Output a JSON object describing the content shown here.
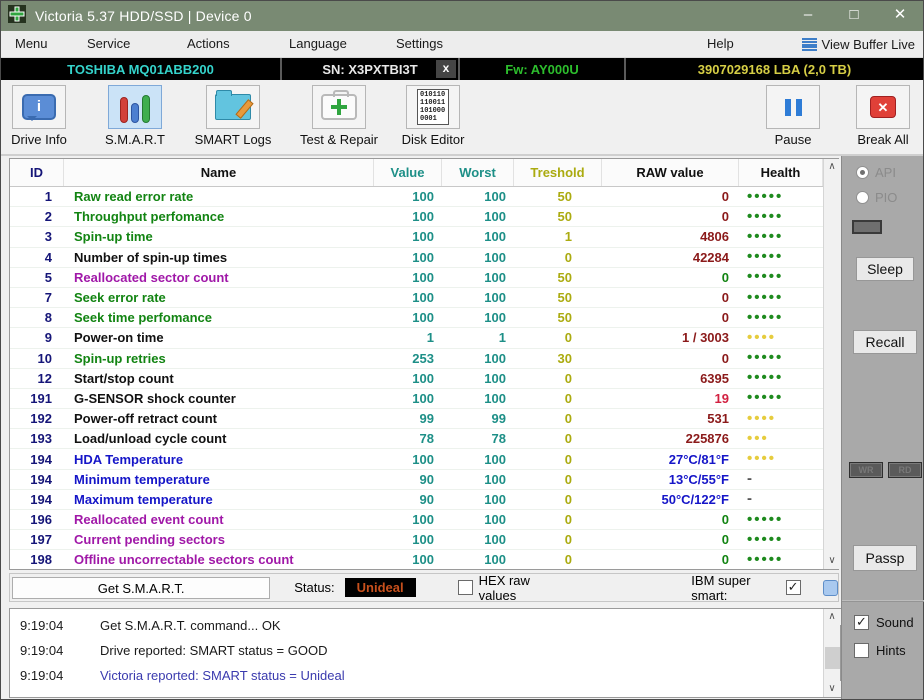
{
  "window": {
    "title": "Victoria 5.37 HDD/SSD | Device 0",
    "minimize": "–",
    "maximize": "□",
    "close": "✕"
  },
  "menubar": {
    "items": [
      "Menu",
      "Service",
      "Actions",
      "Language",
      "Settings",
      "Help"
    ],
    "view_buffer": "View Buffer Live"
  },
  "drivebar": {
    "model": "TOSHIBA MQ01ABB200",
    "serial": "SN: X3PXTBI3T",
    "close": "x",
    "firmware": "Fw: AY000U",
    "capacity": "3907029168 LBA (2,0 TB)"
  },
  "toolbar": {
    "buttons": [
      {
        "label": "Drive Info"
      },
      {
        "label": "S.M.A.R.T"
      },
      {
        "label": "SMART Logs"
      },
      {
        "label": "Test & Repair"
      },
      {
        "label": "Disk Editor"
      }
    ],
    "disk_editor_binary": [
      "010110",
      "110011",
      "101000",
      "0001"
    ],
    "pause": "Pause",
    "break_all": "Break All"
  },
  "smart_table": {
    "columns": [
      "ID",
      "Name",
      "Value",
      "Worst",
      "Treshold",
      "RAW value",
      "Health"
    ],
    "rows": [
      {
        "id": "1",
        "name": "Raw read error rate",
        "name_color": "green",
        "value": "100",
        "worst": "100",
        "treshold": "50",
        "raw": "0",
        "raw_color": "maroon",
        "health": {
          "dots": 5,
          "color": "green"
        }
      },
      {
        "id": "2",
        "name": "Throughput perfomance",
        "name_color": "green",
        "value": "100",
        "worst": "100",
        "treshold": "50",
        "raw": "0",
        "raw_color": "maroon",
        "health": {
          "dots": 5,
          "color": "green"
        }
      },
      {
        "id": "3",
        "name": "Spin-up time",
        "name_color": "green",
        "value": "100",
        "worst": "100",
        "treshold": "1",
        "raw": "4806",
        "raw_color": "maroon",
        "health": {
          "dots": 5,
          "color": "green"
        }
      },
      {
        "id": "4",
        "name": "Number of spin-up times",
        "name_color": "black",
        "value": "100",
        "worst": "100",
        "treshold": "0",
        "raw": "42284",
        "raw_color": "maroon",
        "health": {
          "dots": 5,
          "color": "green"
        }
      },
      {
        "id": "5",
        "name": "Reallocated sector count",
        "name_color": "purple",
        "value": "100",
        "worst": "100",
        "treshold": "50",
        "raw": "0",
        "raw_color": "green",
        "health": {
          "dots": 5,
          "color": "green"
        }
      },
      {
        "id": "7",
        "name": "Seek error rate",
        "name_color": "green",
        "value": "100",
        "worst": "100",
        "treshold": "50",
        "raw": "0",
        "raw_color": "maroon",
        "health": {
          "dots": 5,
          "color": "green"
        }
      },
      {
        "id": "8",
        "name": "Seek time perfomance",
        "name_color": "green",
        "value": "100",
        "worst": "100",
        "treshold": "50",
        "raw": "0",
        "raw_color": "maroon",
        "health": {
          "dots": 5,
          "color": "green"
        }
      },
      {
        "id": "9",
        "name": "Power-on time",
        "name_color": "black",
        "value": "1",
        "worst": "1",
        "treshold": "0",
        "raw": "1 / 3003",
        "raw_color": "maroon",
        "health": {
          "dots": 4,
          "color": "yellow"
        }
      },
      {
        "id": "10",
        "name": "Spin-up retries",
        "name_color": "green",
        "value": "253",
        "worst": "100",
        "treshold": "30",
        "raw": "0",
        "raw_color": "maroon",
        "health": {
          "dots": 5,
          "color": "green"
        }
      },
      {
        "id": "12",
        "name": "Start/stop count",
        "name_color": "black",
        "value": "100",
        "worst": "100",
        "treshold": "0",
        "raw": "6395",
        "raw_color": "maroon",
        "health": {
          "dots": 5,
          "color": "green"
        }
      },
      {
        "id": "191",
        "name": "G-SENSOR shock counter",
        "name_color": "black",
        "value": "100",
        "worst": "100",
        "treshold": "0",
        "raw": "19",
        "raw_color": "red",
        "health": {
          "dots": 5,
          "color": "green"
        }
      },
      {
        "id": "192",
        "name": "Power-off retract count",
        "name_color": "black",
        "value": "99",
        "worst": "99",
        "treshold": "0",
        "raw": "531",
        "raw_color": "maroon",
        "health": {
          "dots": 4,
          "color": "yellow"
        }
      },
      {
        "id": "193",
        "name": "Load/unload cycle count",
        "name_color": "black",
        "value": "78",
        "worst": "78",
        "treshold": "0",
        "raw": "225876",
        "raw_color": "maroon",
        "health": {
          "dots": 3,
          "color": "yellow"
        }
      },
      {
        "id": "194",
        "name": "HDA Temperature",
        "name_color": "blue",
        "value": "100",
        "worst": "100",
        "treshold": "0",
        "raw": "27°C/81°F",
        "raw_color": "blue",
        "health": {
          "dots": 4,
          "color": "yellow"
        }
      },
      {
        "id": "194",
        "name": "Minimum temperature",
        "name_color": "blue",
        "value": "90",
        "worst": "100",
        "treshold": "0",
        "raw": "13°C/55°F",
        "raw_color": "blue",
        "health": {
          "text": "-"
        }
      },
      {
        "id": "194",
        "name": "Maximum temperature",
        "name_color": "blue",
        "value": "90",
        "worst": "100",
        "treshold": "0",
        "raw": "50°C/122°F",
        "raw_color": "blue",
        "health": {
          "text": "-"
        }
      },
      {
        "id": "196",
        "name": "Reallocated event count",
        "name_color": "purple",
        "value": "100",
        "worst": "100",
        "treshold": "0",
        "raw": "0",
        "raw_color": "green",
        "health": {
          "dots": 5,
          "color": "green"
        }
      },
      {
        "id": "197",
        "name": "Current pending sectors",
        "name_color": "purple",
        "value": "100",
        "worst": "100",
        "treshold": "0",
        "raw": "0",
        "raw_color": "green",
        "health": {
          "dots": 5,
          "color": "green"
        }
      },
      {
        "id": "198",
        "name": "Offline uncorrectable sectors count",
        "name_color": "purple",
        "value": "100",
        "worst": "100",
        "treshold": "0",
        "raw": "0",
        "raw_color": "green",
        "health": {
          "dots": 5,
          "color": "green"
        }
      }
    ]
  },
  "statusbar": {
    "get_smart": "Get S.M.A.R.T.",
    "status_label": "Status:",
    "status_value": "Unideal",
    "hex_label": "HEX raw values",
    "ibm_label": "IBM super smart:"
  },
  "side_panel": {
    "api_label": "API",
    "pio_label": "PIO",
    "sleep": "Sleep",
    "recall": "Recall",
    "wr": "WR",
    "rd": "RD",
    "passp": "Passp"
  },
  "log": {
    "entries": [
      {
        "time": "9:19:04",
        "message": "Get S.M.A.R.T. command... OK",
        "color": "black"
      },
      {
        "time": "9:19:04",
        "message": "Drive reported: SMART status = GOOD",
        "color": "black"
      },
      {
        "time": "9:19:04",
        "message": "Victoria reported: SMART status = Unideal",
        "color": "blue"
      }
    ]
  },
  "options": {
    "sound": "Sound",
    "hints": "Hints"
  },
  "colors": {
    "titlebar_green": "#798A73",
    "model_cyan": "#35D4CC",
    "firmware_green": "#2DBE2D",
    "capacity_yellow": "#D6CE45",
    "status_unideal": "#C8501C",
    "health_green": "#1E8A1E",
    "health_yellow": "#E6CC3E",
    "value_teal": "#1D8F87",
    "treshold_olive": "#ABAB10",
    "raw_maroon": "#8B1A1A"
  }
}
